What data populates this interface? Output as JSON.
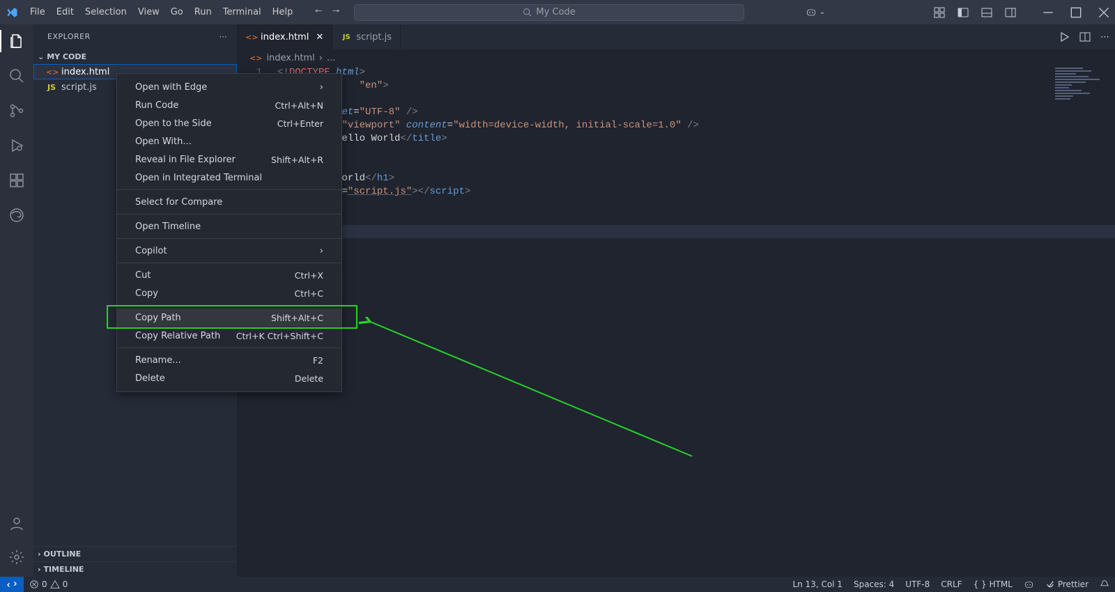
{
  "titlebar": {
    "menus": [
      "File",
      "Edit",
      "Selection",
      "View",
      "Go",
      "Run",
      "Terminal",
      "Help"
    ],
    "searchLabel": "My Code"
  },
  "explorer": {
    "title": "EXPLORER",
    "project": "MY CODE",
    "files": [
      {
        "name": "index.html",
        "icon": "html",
        "selected": true
      },
      {
        "name": "script.js",
        "icon": "js"
      }
    ],
    "outline": "OUTLINE",
    "timeline": "TIMELINE"
  },
  "tabs": [
    {
      "name": "index.html",
      "icon": "html",
      "active": true,
      "close": true
    },
    {
      "name": "script.js",
      "icon": "js",
      "active": false
    }
  ],
  "breadcrumbs": {
    "file": "index.html",
    "rest": "..."
  },
  "context": {
    "items": [
      {
        "label": "Open with Edge",
        "sub": true
      },
      {
        "label": "Run Code",
        "shortcut": "Ctrl+Alt+N"
      },
      {
        "label": "Open to the Side",
        "shortcut": "Ctrl+Enter"
      },
      {
        "label": "Open With..."
      },
      {
        "label": "Reveal in File Explorer",
        "shortcut": "Shift+Alt+R"
      },
      {
        "label": "Open in Integrated Terminal"
      },
      {
        "sep": true
      },
      {
        "label": "Select for Compare"
      },
      {
        "sep": true
      },
      {
        "label": "Open Timeline"
      },
      {
        "sep": true
      },
      {
        "label": "Copilot",
        "sub": true
      },
      {
        "sep": true
      },
      {
        "label": "Cut",
        "shortcut": "Ctrl+X"
      },
      {
        "label": "Copy",
        "shortcut": "Ctrl+C"
      },
      {
        "sep": true
      },
      {
        "label": "Copy Path",
        "shortcut": "Shift+Alt+C",
        "hover": true
      },
      {
        "label": "Copy Relative Path",
        "shortcut": "Ctrl+K Ctrl+Shift+C"
      },
      {
        "sep": true
      },
      {
        "label": "Rename...",
        "shortcut": "F2"
      },
      {
        "label": "Delete",
        "shortcut": "Delete"
      }
    ]
  },
  "status": {
    "errors": "0",
    "warnings": "0",
    "ln": "Ln 13, Col 1",
    "spaces": "Spaces: 4",
    "enc": "UTF-8",
    "eol": "CRLF",
    "lang": "{ } HTML",
    "prettier": "Prettier"
  }
}
